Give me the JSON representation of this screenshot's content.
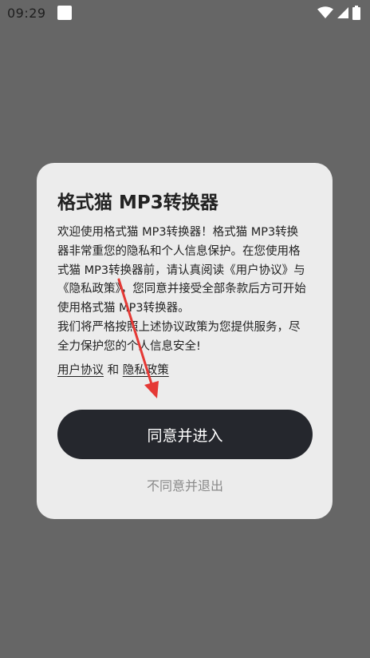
{
  "status_bar": {
    "time": "09:29",
    "icons": [
      "notification-square-icon",
      "wifi-icon",
      "signal-icon",
      "battery-icon"
    ]
  },
  "dialog": {
    "title": "格式猫 MP3转换器",
    "body_paragraph_1": "欢迎使用格式猫 MP3转换器！格式猫 MP3转换器非常重您的隐私和个人信息保护。在您使用格式猫 MP3转换器前，请认真阅读《用户协议》与《隐私政策》，您同意并接受全部条款后方可开始使用格式猫 MP3转换器。",
    "body_paragraph_2": "我们将严格按照上述协议政策为您提供服务，尽全力保护您的个人信息安全!",
    "user_agreement_link": "用户协议",
    "link_separator": "和",
    "privacy_policy_link": "隐私政策",
    "agree_button": "同意并进入",
    "decline_button": "不同意并退出"
  },
  "colors": {
    "backdrop": "#666666",
    "dialog_bg": "#ececec",
    "primary_button": "#25272d",
    "annotation_arrow": "#e53935"
  }
}
